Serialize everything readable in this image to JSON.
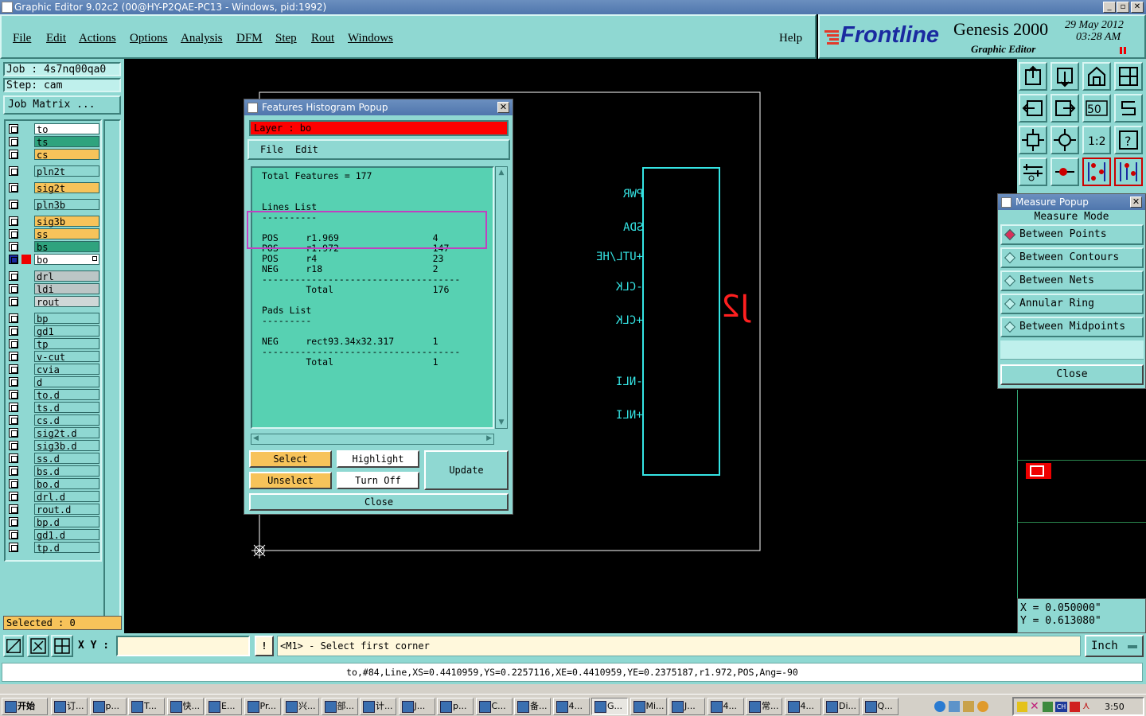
{
  "window": {
    "title": "Graphic Editor 9.02c2 (00@HY-P2QAE-PC13 - Windows, pid:1992)",
    "min": "_",
    "max": "▫",
    "close": "✕"
  },
  "menu": {
    "items": [
      "File",
      "Edit",
      "Actions",
      "Options",
      "Analysis",
      "DFM",
      "Step",
      "Rout",
      "Windows"
    ],
    "help": "Help"
  },
  "brand": {
    "logo": "Frontline",
    "product": "Genesis 2000",
    "subtitle": "Graphic Editor",
    "date": "29 May 2012",
    "time": "03:28 AM"
  },
  "job": {
    "job_line": "Job : 4s7nq00qa0",
    "step_line": "Step: cam",
    "matrix_button": "Job Matrix ..."
  },
  "layers": [
    {
      "name": "to",
      "color": "#ffffff"
    },
    {
      "name": "ts",
      "color": "#2fa37e"
    },
    {
      "name": "cs",
      "color": "#f7c35a"
    },
    {
      "name": "pln2t",
      "color": "#8fd8d2"
    },
    {
      "name": "sig2t",
      "color": "#f7c35a"
    },
    {
      "name": "pln3b",
      "color": "#8fd8d2"
    },
    {
      "name": "sig3b",
      "color": "#f7c35a"
    },
    {
      "name": "ss",
      "color": "#f7c35a"
    },
    {
      "name": "bs",
      "color": "#2fa37e"
    },
    {
      "name": "bo",
      "color": "#ffffff"
    },
    {
      "name": "drl",
      "color": "#bcc6c6"
    },
    {
      "name": "ldi",
      "color": "#bcc6c6"
    },
    {
      "name": "rout",
      "color": "#cfd7d7"
    },
    {
      "name": "bp",
      "color": "#8fd8d2"
    },
    {
      "name": "gd1",
      "color": "#8fd8d2"
    },
    {
      "name": "tp",
      "color": "#8fd8d2"
    },
    {
      "name": "v-cut",
      "color": "#8fd8d2"
    },
    {
      "name": "cvia",
      "color": "#8fd8d2"
    },
    {
      "name": "d",
      "color": "#8fd8d2"
    },
    {
      "name": "to.d",
      "color": "#8fd8d2"
    },
    {
      "name": "ts.d",
      "color": "#8fd8d2"
    },
    {
      "name": "cs.d",
      "color": "#8fd8d2"
    },
    {
      "name": "sig2t.d",
      "color": "#8fd8d2"
    },
    {
      "name": "sig3b.d",
      "color": "#8fd8d2"
    },
    {
      "name": "ss.d",
      "color": "#8fd8d2"
    },
    {
      "name": "bs.d",
      "color": "#8fd8d2"
    },
    {
      "name": "bo.d",
      "color": "#8fd8d2"
    },
    {
      "name": "drl.d",
      "color": "#8fd8d2"
    },
    {
      "name": "rout.d",
      "color": "#8fd8d2"
    },
    {
      "name": "bp.d",
      "color": "#8fd8d2"
    },
    {
      "name": "gd1.d",
      "color": "#8fd8d2"
    },
    {
      "name": "tp.d",
      "color": "#8fd8d2"
    }
  ],
  "selected": "Selected : 0",
  "histogram": {
    "title": "Features Histogram Popup",
    "layer_label": "Layer :  bo",
    "menu": [
      "File",
      "Edit"
    ],
    "lines": [
      "Total Features = 177",
      "",
      "",
      "Lines List",
      "----------",
      "",
      "POS     r1.969                 4",
      "POS     r1.972                 147",
      "POS     r4                     23",
      "NEG     r18                    2",
      "------------------------------------",
      "        Total                  176",
      "",
      "Pads List",
      "---------",
      "",
      "NEG     rect93.34x32.317       1",
      "------------------------------------",
      "        Total                  1"
    ],
    "buttons": {
      "select": "Select",
      "highlight": "Highlight",
      "update": "Update",
      "unselect": "Unselect",
      "turn_off": "Turn Off",
      "close": "Close"
    }
  },
  "canvas": {
    "pins": [
      "PWR",
      "SDA",
      "+UTL/HE",
      "-CLK",
      "+CLK",
      "-NLI",
      "+NLI"
    ],
    "refdes": "J2"
  },
  "measure": {
    "title": "Measure Popup",
    "mode_label": "Measure Mode",
    "options": [
      "Between Points",
      "Between Contours",
      "Between Nets",
      "Annular Ring",
      "Between Midpoints"
    ],
    "selected_index": 0,
    "close": "Close"
  },
  "coords": {
    "x": "X  = 0.050000\"",
    "y": "Y  = 0.613080\""
  },
  "cmd": {
    "xy_label": "X Y :",
    "xy_value": "",
    "prompt": "<M1> - Select first corner",
    "units": "Inch"
  },
  "status": "to,#84,Line,XS=0.4410959,YS=0.2257116,XE=0.4410959,YE=0.2375187,r1.972,POS,Ang=-90",
  "taskbar": {
    "start": "开始",
    "items": [
      "订...",
      "p...",
      "T...",
      "快...",
      "E...",
      "Pr...",
      "兴...",
      "部...",
      "计...",
      "J...",
      "p...",
      "C...",
      "备...",
      "4...",
      "G...",
      "Mi...",
      "J...",
      "4...",
      "常...",
      "4...",
      "Di...",
      "Q..."
    ],
    "active_index": 14,
    "clock": "3:50",
    "lang": "CH"
  }
}
